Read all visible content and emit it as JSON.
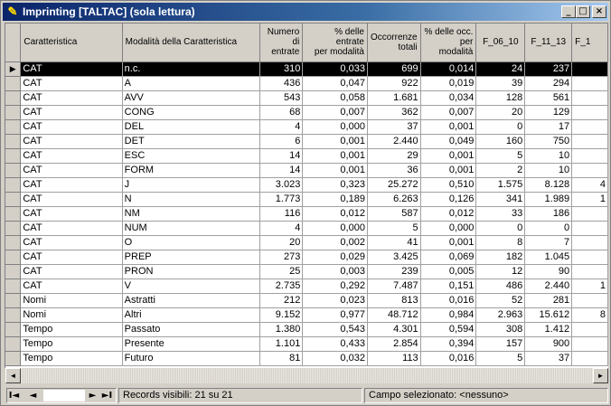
{
  "window": {
    "title": "Imprinting [TALTAC] (sola lettura)",
    "minimize_glyph": "_",
    "maximize_glyph": "□",
    "close_glyph": "×"
  },
  "grid": {
    "columns": [
      {
        "label": "Caratteristica",
        "align": "left"
      },
      {
        "label": "Modalità della Caratteristica",
        "align": "left"
      },
      {
        "label": "Numero\ndi\nentrate",
        "align": "right"
      },
      {
        "label": "% delle entrate\nper modalità",
        "align": "right"
      },
      {
        "label": "Occorrenze\ntotali",
        "align": "right"
      },
      {
        "label": "% delle occ.\nper modalità",
        "align": "right"
      },
      {
        "label": "F_06_10",
        "align": "center"
      },
      {
        "label": "F_11_13",
        "align": "center"
      },
      {
        "label": "F_1",
        "align": "left"
      }
    ],
    "current_row_marker": "▶",
    "rows": [
      [
        "CAT",
        "n.c.",
        "310",
        "0,033",
        "699",
        "0,014",
        "24",
        "237",
        ""
      ],
      [
        "CAT",
        "A",
        "436",
        "0,047",
        "922",
        "0,019",
        "39",
        "294",
        ""
      ],
      [
        "CAT",
        "AVV",
        "543",
        "0,058",
        "1.681",
        "0,034",
        "128",
        "561",
        ""
      ],
      [
        "CAT",
        "CONG",
        "68",
        "0,007",
        "362",
        "0,007",
        "20",
        "129",
        ""
      ],
      [
        "CAT",
        "DEL",
        "4",
        "0,000",
        "37",
        "0,001",
        "0",
        "17",
        ""
      ],
      [
        "CAT",
        "DET",
        "6",
        "0,001",
        "2.440",
        "0,049",
        "160",
        "750",
        ""
      ],
      [
        "CAT",
        "ESC",
        "14",
        "0,001",
        "29",
        "0,001",
        "5",
        "10",
        ""
      ],
      [
        "CAT",
        "FORM",
        "14",
        "0,001",
        "36",
        "0,001",
        "2",
        "10",
        ""
      ],
      [
        "CAT",
        "J",
        "3.023",
        "0,323",
        "25.272",
        "0,510",
        "1.575",
        "8.128",
        "4"
      ],
      [
        "CAT",
        "N",
        "1.773",
        "0,189",
        "6.263",
        "0,126",
        "341",
        "1.989",
        "1"
      ],
      [
        "CAT",
        "NM",
        "116",
        "0,012",
        "587",
        "0,012",
        "33",
        "186",
        ""
      ],
      [
        "CAT",
        "NUM",
        "4",
        "0,000",
        "5",
        "0,000",
        "0",
        "0",
        ""
      ],
      [
        "CAT",
        "O",
        "20",
        "0,002",
        "41",
        "0,001",
        "8",
        "7",
        ""
      ],
      [
        "CAT",
        "PREP",
        "273",
        "0,029",
        "3.425",
        "0,069",
        "182",
        "1.045",
        ""
      ],
      [
        "CAT",
        "PRON",
        "25",
        "0,003",
        "239",
        "0,005",
        "12",
        "90",
        ""
      ],
      [
        "CAT",
        "V",
        "2.735",
        "0,292",
        "7.487",
        "0,151",
        "486",
        "2.440",
        "1"
      ],
      [
        "Nomi",
        "Astratti",
        "212",
        "0,023",
        "813",
        "0,016",
        "52",
        "281",
        ""
      ],
      [
        "Nomi",
        "Altri",
        "9.152",
        "0,977",
        "48.712",
        "0,984",
        "2.963",
        "15.612",
        "8"
      ],
      [
        "Tempo",
        "Passato",
        "1.380",
        "0,543",
        "4.301",
        "0,594",
        "308",
        "1.412",
        ""
      ],
      [
        "Tempo",
        "Presente",
        "1.101",
        "0,433",
        "2.854",
        "0,394",
        "157",
        "900",
        ""
      ],
      [
        "Tempo",
        "Futuro",
        "81",
        "0,032",
        "113",
        "0,016",
        "5",
        "37",
        ""
      ]
    ]
  },
  "scrollbar": {
    "left_arrow": "◄",
    "right_arrow": "►"
  },
  "navigator": {
    "first": "I◄",
    "prev": "◄",
    "next": "►",
    "last": "►I"
  },
  "status": {
    "records": "Records visibili: 21 su 21",
    "selected_field": "Campo selezionato: <nessuno>"
  }
}
